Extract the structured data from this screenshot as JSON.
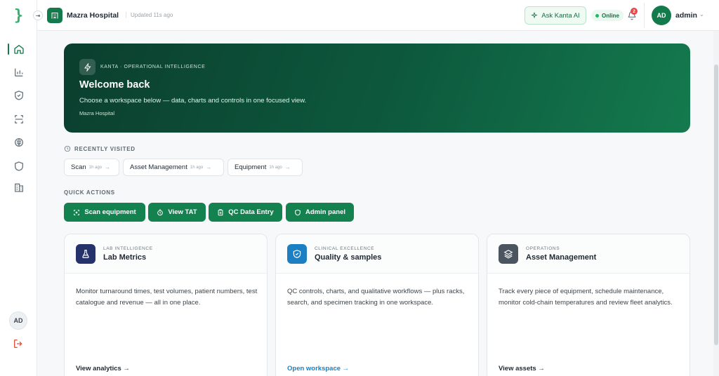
{
  "sidebar": {
    "logo_glyph": "}",
    "collapse_glyph": "⇥",
    "nav": [
      {
        "name": "home",
        "icon": "home-icon",
        "active": true
      },
      {
        "name": "analytics",
        "icon": "bar-chart-icon"
      },
      {
        "name": "quality",
        "icon": "shield-check-icon"
      },
      {
        "name": "scan",
        "icon": "scan-icon"
      },
      {
        "name": "intelligence",
        "icon": "brain-icon"
      },
      {
        "name": "security",
        "icon": "shield-icon"
      },
      {
        "name": "facilities",
        "icon": "building-icon"
      }
    ],
    "avatar_initials": "AD"
  },
  "header": {
    "hospital_name": "Mazra Hospital",
    "updated_text": "Updated 11s ago",
    "ask_label": "Ask Kanta AI",
    "status_label": "Online",
    "notification_count": "2",
    "user_initials": "AD",
    "user_name": "admin",
    "user_chevron": "⌄"
  },
  "hero": {
    "eyebrow": "KANTA · OPERATIONAL INTELLIGENCE",
    "title": "Welcome back",
    "subtitle": "Choose a workspace below — data, charts and controls in one focused view.",
    "hospital": "Mazra Hospital"
  },
  "recent": {
    "label": "RECENTLY VISITED",
    "items": [
      {
        "label": "Scan",
        "ago": "1h ago",
        "arrow": "→"
      },
      {
        "label": "Asset Management",
        "ago": "1h ago",
        "arrow": "→"
      },
      {
        "label": "Equipment",
        "ago": "1h ago",
        "arrow": "→"
      }
    ]
  },
  "quick_actions": {
    "label": "QUICK ACTIONS",
    "items": [
      {
        "label": "Scan equipment",
        "icon": "scan-icon"
      },
      {
        "label": "View TAT",
        "icon": "timer-icon"
      },
      {
        "label": "QC Data Entry",
        "icon": "clipboard-icon"
      },
      {
        "label": "Admin panel",
        "icon": "shield-icon"
      }
    ]
  },
  "cards": [
    {
      "eyebrow": "LAB INTELLIGENCE",
      "title": "Lab Metrics",
      "description": "Monitor turnaround times, test volumes, patient numbers, test catalogue and revenue — all in one place.",
      "link": "View analytics →",
      "icon": "flask-icon",
      "color": "#26336b",
      "link_color": "#1f2933"
    },
    {
      "eyebrow": "CLINICAL EXCELLENCE",
      "title": "Quality & samples",
      "description": "QC controls, charts, and qualitative workflows — plus racks, search, and specimen tracking in one workspace.",
      "link": "Open workspace →",
      "icon": "shield-check-icon",
      "color": "#1b7fc2",
      "link_color": "#1b7fc2"
    },
    {
      "eyebrow": "OPERATIONS",
      "title": "Asset Management",
      "description": "Track every piece of equipment, schedule maintenance, monitor cold-chain temperatures and review fleet analytics.",
      "link": "View assets →",
      "icon": "layers-icon",
      "color": "#4a5560",
      "link_color": "#1f2933"
    }
  ]
}
